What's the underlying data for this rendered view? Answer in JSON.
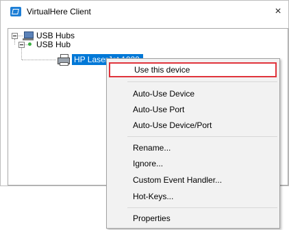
{
  "window": {
    "title": "VirtualHere Client",
    "close_glyph": "×",
    "app_icon": "virtualhere-app-icon"
  },
  "tree": {
    "root": {
      "label": "USB Hubs",
      "icon": "usb-hubs-icon",
      "expanded": true
    },
    "hub": {
      "label": "USB Hub",
      "icon": "usb-hub-status-dot",
      "expanded": true
    },
    "device": {
      "label": "HP LaserJet 1020",
      "icon": "printer-icon",
      "selected": true
    }
  },
  "context_menu": {
    "items": [
      {
        "label": "Use this device",
        "highlighted": true
      },
      {
        "label": "Auto-Use Device"
      },
      {
        "label": "Auto-Use Port"
      },
      {
        "label": "Auto-Use Device/Port"
      },
      {
        "label": "Rename..."
      },
      {
        "label": "Ignore..."
      },
      {
        "label": "Custom Event Handler..."
      },
      {
        "label": "Hot-Keys..."
      },
      {
        "label": "Properties"
      }
    ]
  },
  "colors": {
    "selection": "#0078d7",
    "highlight_border": "#e0323a",
    "menu_background": "#f2f2f2"
  }
}
